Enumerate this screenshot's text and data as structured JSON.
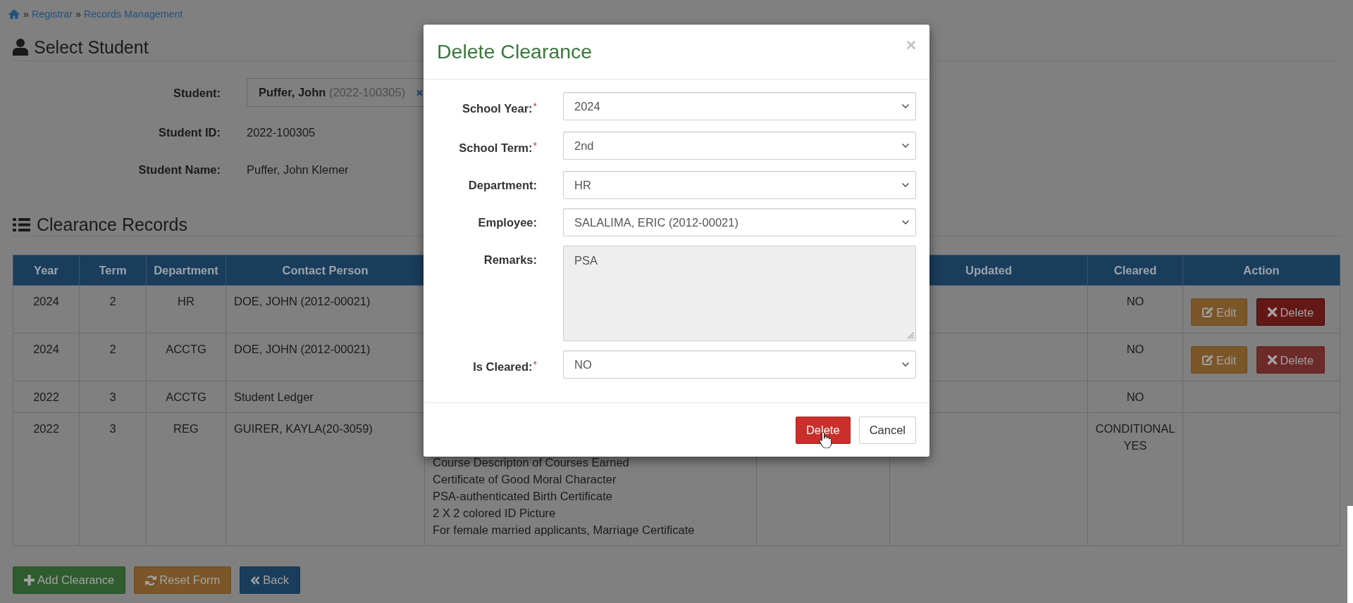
{
  "breadcrumb": [
    {
      "separator": "»",
      "label": "Registrar"
    },
    {
      "separator": "»",
      "label": "Records Management"
    }
  ],
  "student_section": {
    "title": "Select Student",
    "fields": [
      {
        "kind": "select",
        "label": "Student:",
        "value": "**Puffer, John** (2022-100305)"
      },
      {
        "kind": "text",
        "label": "Student ID:",
        "value": "2022-100305"
      },
      {
        "kind": "text",
        "label": "Student Name:",
        "value": "Puffer, John Klemer"
      }
    ]
  },
  "records_section": {
    "title": "Clearance Records",
    "table": {
      "columns": [
        {
          "label": "Year"
        },
        {
          "label": "Term"
        },
        {
          "label": "Department"
        },
        {
          "label": "Contact Person"
        },
        {},
        {},
        {
          "label": "Updated"
        },
        {
          "label": "Cleared"
        },
        {
          "label": "Action"
        }
      ],
      "rows": [
        {
          "year": "2024",
          "term": "2",
          "department": "HR",
          "contact_person": "DOE, JOHN (2012-00021)",
          "cleared": "NO",
          "actions": [
            {
              "kind": "edit",
              "label": "Edit",
              "focused": false
            },
            {
              "kind": "delete",
              "label": "Delete",
              "focused": true
            }
          ]
        },
        {
          "year": "2024",
          "term": "2",
          "department": "ACCTG",
          "contact_person": "DOE, JOHN (2012-00021)",
          "cleared": "NO",
          "actions": [
            {
              "kind": "edit",
              "label": "Edit",
              "focused": false
            },
            {
              "kind": "delete",
              "label": "Delete",
              "focused": false
            }
          ]
        },
        {
          "year": "2022",
          "term": "3",
          "department": "ACCTG",
          "contact_person": "Student Ledger",
          "cleared": "NO"
        },
        {
          "year": "2022",
          "term": "3",
          "department": "REG",
          "contact_person": "GUIRER, KAYLA(20-3059)",
          "column_5": [
            "Course Descripton of Courses Earned",
            "Certificate of Good Moral Character",
            "PSA-authenticated Birth Certificate",
            "2 X 2 colored ID Picture",
            "For female married applicants, Marriage Certificate"
          ],
          "cleared": "CONDITIONAL YES"
        }
      ]
    }
  },
  "buttons": [
    {
      "kind": "add",
      "label": "Add Clearance"
    },
    {
      "kind": "reset",
      "label": "Reset Form"
    },
    {
      "kind": "back",
      "label": "Back"
    }
  ],
  "modal": {
    "title": "Delete Clearance",
    "fields": [
      {
        "kind": "select",
        "label": "School Year:",
        "required_mark": "*",
        "value": "2024"
      },
      {
        "kind": "select",
        "label": "School Term:",
        "required_mark": "*",
        "value": "2nd"
      },
      {
        "kind": "select",
        "label": "Department:",
        "value": "HR"
      },
      {
        "kind": "select",
        "label": "Employee:",
        "value": "SALALIMA, ERIC (2012-00021)"
      },
      {
        "kind": "textarea",
        "label": "Remarks:",
        "value": "PSA"
      },
      {
        "kind": "select",
        "label": "Is Cleared:",
        "required_mark": "*",
        "value": "NO"
      }
    ],
    "buttons": [
      {
        "kind": "danger",
        "label": "Delete"
      },
      {
        "kind": "default",
        "label": "Cancel"
      }
    ]
  }
}
